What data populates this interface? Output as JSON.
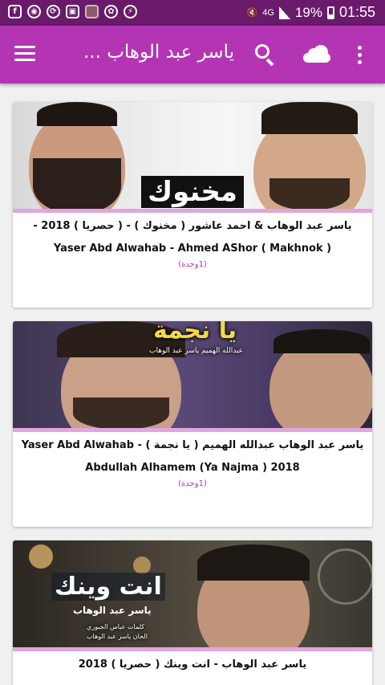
{
  "status_bar": {
    "network": "4G",
    "battery": "19%",
    "time": "01:55",
    "notification_icons": [
      "facebook-icon",
      "cast-icon",
      "sync-icon",
      "photo-icon",
      "game-icon",
      "messenger-icon"
    ]
  },
  "app_bar": {
    "title": "ياسر عبد الوهاب ...",
    "color": "#b435b4"
  },
  "cards": [
    {
      "title_ar": "ياسر عبد الوهاب & احمد عاشور ( مخنوك ) - ( حصريا ) 2018 -",
      "title_en": "Yaser Abd Alwahab - Ahmed AShor ( Makhnok )",
      "count": "(1وحدة)",
      "overlay": "مخنوك"
    },
    {
      "title_ar": "ياسر عبد الوهاب  عبدالله الهميم ( يا نجمة ) - Yaser Abd Alwahab",
      "title_en": "Abdullah Alhamem (Ya Najma ) 2018",
      "count": "(1وحدة)",
      "overlay": "يا نجمة",
      "overlay_sub": "عبدالله الهميم ياسر عبد الوهاب"
    },
    {
      "title_ar": "ياسر عبد الوهاب - انت وينك ( حصريا ) 2018",
      "overlay": "انت وينك",
      "overlay_sub": "ياسر عبد الوهاب",
      "overlay_small1": "كلمات عباس الجبوري",
      "overlay_small2": "الحان ياسر عبد الوهاب"
    }
  ]
}
